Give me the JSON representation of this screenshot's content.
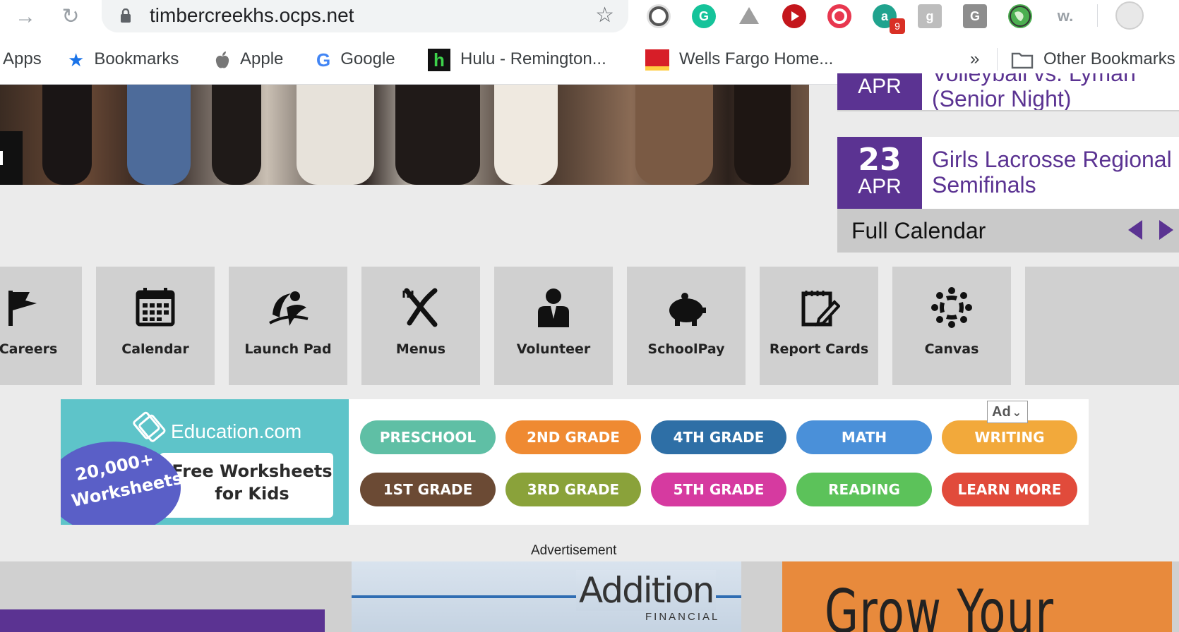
{
  "browser": {
    "url": "timbercreekhs.ocps.net",
    "extension_badge": "9",
    "bookmarks": [
      {
        "label": "Apps",
        "icon": "apps-grid-icon"
      },
      {
        "label": "Bookmarks",
        "icon": "star-icon"
      },
      {
        "label": "Apple",
        "icon": "apple-icon"
      },
      {
        "label": "Google",
        "icon": "google-icon"
      },
      {
        "label": "Hulu - Remington...",
        "icon": "hulu-icon"
      },
      {
        "label": "Wells Fargo Home...",
        "icon": "wells-fargo-icon"
      }
    ],
    "overflow_label": "»",
    "other_bookmarks": "Other Bookmarks"
  },
  "events": [
    {
      "month": "APR",
      "title_line1": "Volleyball vs. Lyman",
      "title_line2": "(Senior Night)"
    },
    {
      "day": "23",
      "month": "APR",
      "title_line1": "Girls Lacrosse Regional",
      "title_line2": "Semifinals"
    }
  ],
  "calendar": {
    "label": "Full Calendar"
  },
  "quick_links": [
    {
      "label": "Careers",
      "icon": "flag-icon"
    },
    {
      "label": "Calendar",
      "icon": "calendar-icon"
    },
    {
      "label": "Launch Pad",
      "icon": "launch-pad-icon"
    },
    {
      "label": "Menus",
      "icon": "fork-knife-icon"
    },
    {
      "label": "Volunteer",
      "icon": "person-icon"
    },
    {
      "label": "SchoolPay",
      "icon": "piggy-bank-icon"
    },
    {
      "label": "Report Cards",
      "icon": "report-card-icon"
    },
    {
      "label": "Canvas",
      "icon": "canvas-icon"
    }
  ],
  "ad": {
    "brand": "Education.com",
    "headline_line1": "Free Worksheets",
    "headline_line2": "for Kids",
    "badge_line1": "20,000+",
    "badge_line2": "Worksheets",
    "choice_label": "Ad",
    "caption": "Advertisement",
    "buttons": [
      {
        "label": "PRESCHOOL",
        "color": "#5fbfa5"
      },
      {
        "label": "2ND GRADE",
        "color": "#ef8a32"
      },
      {
        "label": "4TH GRADE",
        "color": "#2e6fa6"
      },
      {
        "label": "MATH",
        "color": "#4a90d9"
      },
      {
        "label": "WRITING",
        "color": "#f2a93b"
      },
      {
        "label": "1ST GRADE",
        "color": "#6b4a34"
      },
      {
        "label": "3RD GRADE",
        "color": "#8aa23a"
      },
      {
        "label": "5TH GRADE",
        "color": "#d63aa0"
      },
      {
        "label": "READING",
        "color": "#5cc25a"
      },
      {
        "label": "LEARN MORE",
        "color": "#e14b3b"
      }
    ]
  },
  "lower_ads": {
    "addition_word": "Addition",
    "addition_sub": "FINANCIAL",
    "orange_text": "Grow Your"
  },
  "colors": {
    "accent": "#5b3392"
  }
}
